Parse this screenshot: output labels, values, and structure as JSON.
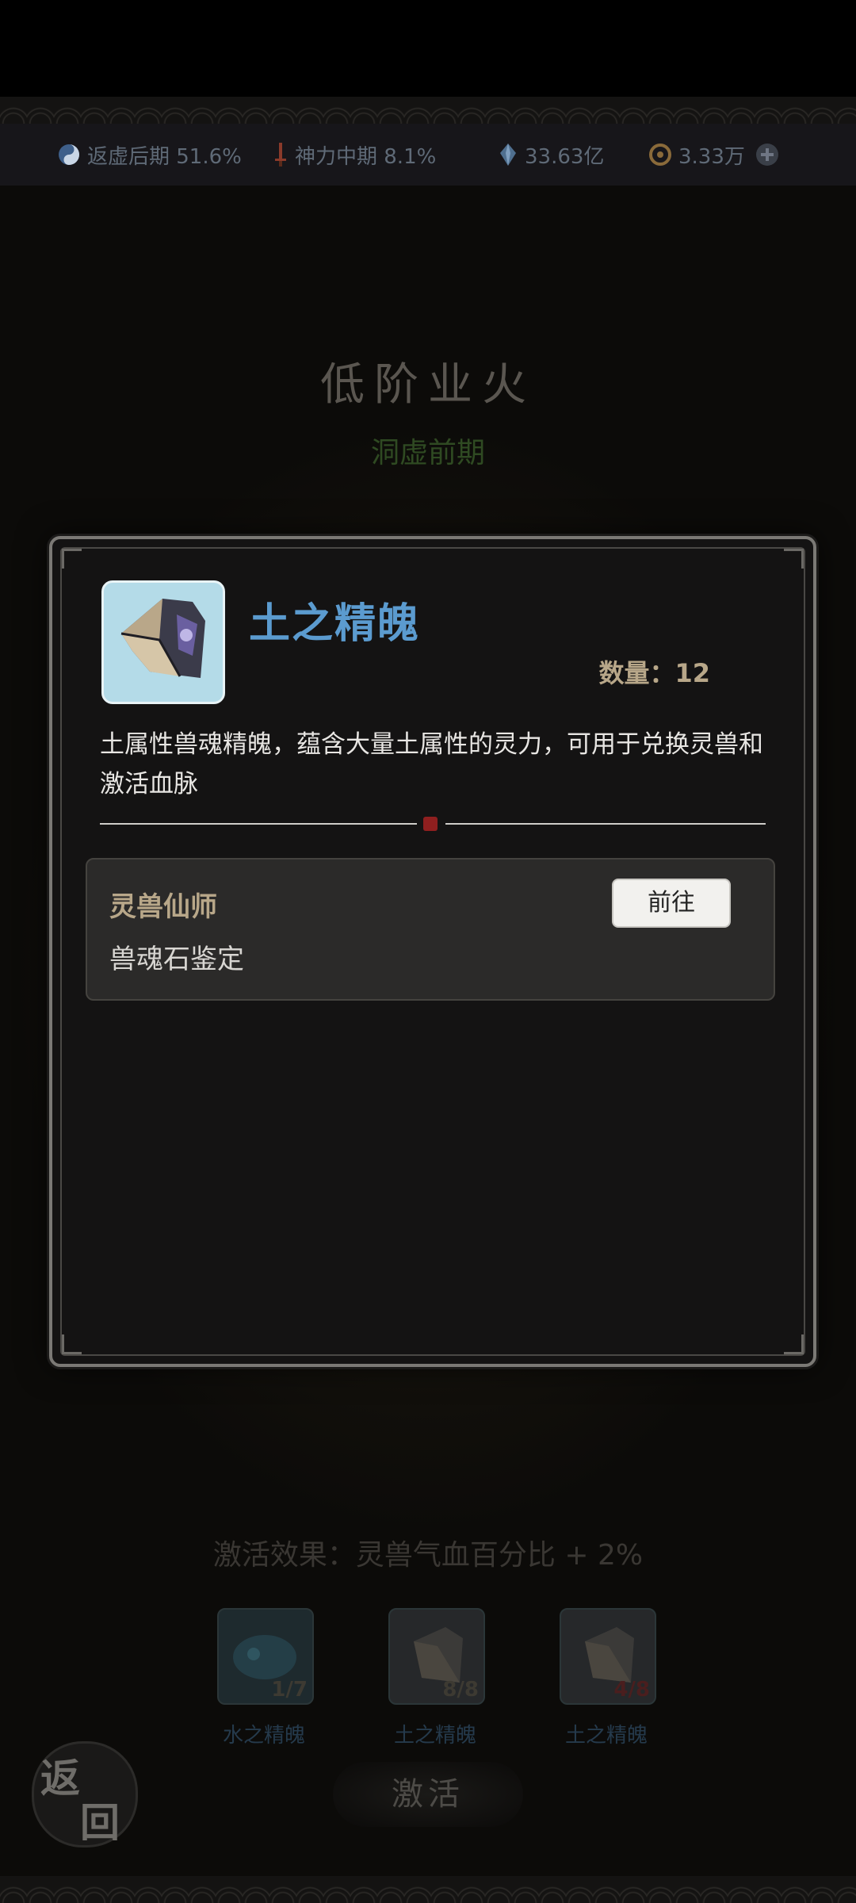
{
  "resources": {
    "cultivation": "返虚后期 51.6%",
    "divine_power": "神力中期 8.1%",
    "spirit_stones": "33.63亿",
    "coins": "3.33万"
  },
  "background": {
    "title": "低阶业火",
    "realm": "洞虚前期",
    "effect": "激活效果：灵兽气血百分比 + 2%",
    "items": [
      {
        "name": "水之精魄",
        "count": "1/7"
      },
      {
        "name": "土之精魄",
        "count": "8/8"
      },
      {
        "name": "土之精魄",
        "count": "4/8"
      }
    ],
    "activate_label": "激活",
    "back_label_1": "返",
    "back_label_2": "回"
  },
  "dialog": {
    "item_name": "土之精魄",
    "quantity": "数量：12",
    "description": "土属性兽魂精魄，蕴含大量土属性的灵力，可用于兑换灵兽和激活血脉",
    "source": {
      "title": "灵兽仙师",
      "subtitle": "兽魂石鉴定",
      "goto_label": "前往"
    }
  },
  "colors": {
    "title_blue": "#5b9bcf",
    "gold_label": "#b8a789",
    "icon_bg": "#b4dbe8"
  }
}
